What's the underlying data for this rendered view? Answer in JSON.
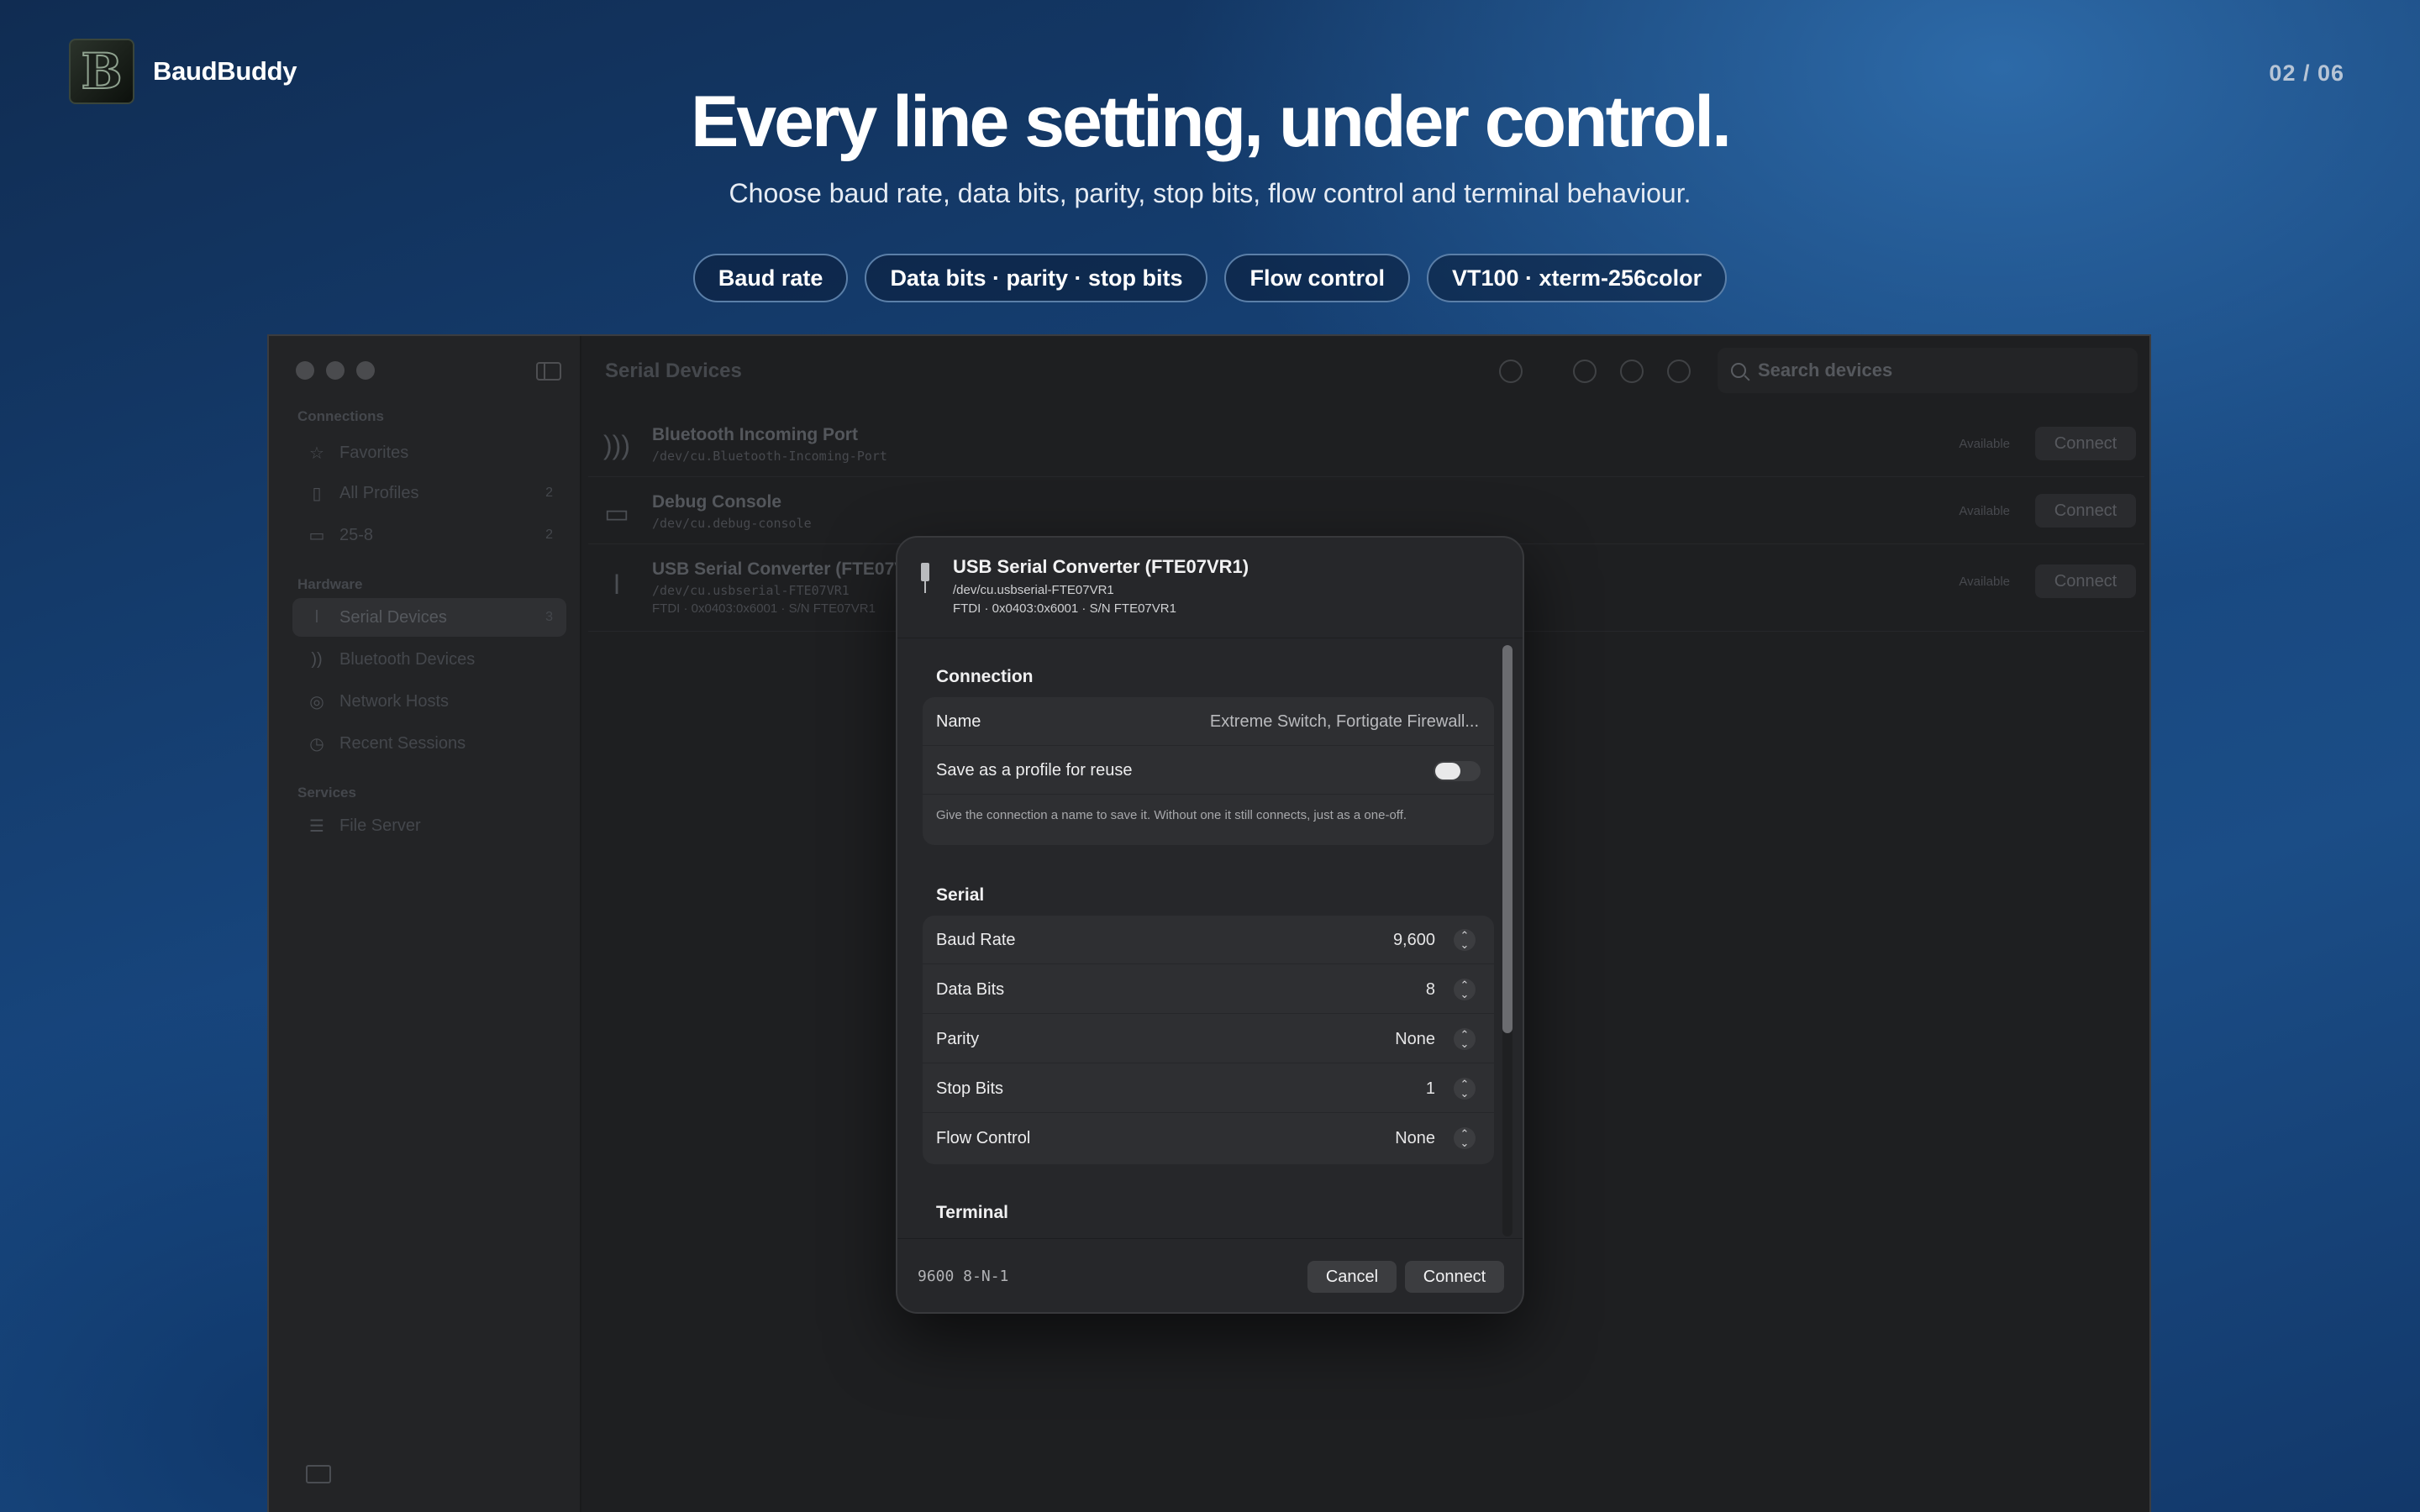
{
  "brand": {
    "name": "BaudBuddy",
    "logo_letter": "B"
  },
  "pager": "02 / 06",
  "headline": "Every line setting, under control.",
  "subline": "Choose baud rate, data bits, parity, stop bits, flow control and terminal behaviour.",
  "pills": [
    "Baud rate",
    "Data bits · parity · stop bits",
    "Flow control",
    "VT100 · xterm-256color"
  ],
  "window": {
    "title": "Serial Devices",
    "search_placeholder": "Search devices",
    "sidebar": {
      "sections": [
        "Connections",
        "Hardware",
        "Services"
      ],
      "connections": [
        {
          "label": "Favorites",
          "icon": "star-icon",
          "count": ""
        },
        {
          "label": "All Profiles",
          "icon": "clipboard-icon",
          "count": "2"
        },
        {
          "label": "25-8",
          "icon": "folder-icon",
          "count": "2"
        }
      ],
      "hardware": [
        {
          "label": "Serial Devices",
          "icon": "usb-icon",
          "count": "3"
        },
        {
          "label": "Bluetooth Devices",
          "icon": "bluetooth-icon",
          "count": ""
        },
        {
          "label": "Network Hosts",
          "icon": "globe-icon",
          "count": ""
        },
        {
          "label": "Recent Sessions",
          "icon": "clock-icon",
          "count": ""
        }
      ],
      "services": [
        {
          "label": "File Server",
          "icon": "server-icon",
          "count": ""
        }
      ]
    },
    "devices": [
      {
        "name": "Bluetooth Incoming Port",
        "path": "/dev/cu.Bluetooth-Incoming-Port",
        "info": "",
        "status": "Available",
        "action": "Connect"
      },
      {
        "name": "Debug Console",
        "path": "/dev/cu.debug-console",
        "info": "",
        "status": "Available",
        "action": "Connect"
      },
      {
        "name": "USB Serial Converter (FTE07V",
        "path": "/dev/cu.usbserial-FTE07VR1",
        "info": "FTDI · 0x0403:0x6001 · S/N FTE07VR1",
        "status": "Available",
        "action": "Connect"
      }
    ]
  },
  "sheet": {
    "title": "USB Serial Converter (FTE07VR1)",
    "path": "/dev/cu.usbserial-FTE07VR1",
    "info": "FTDI · 0x0403:0x6001 · S/N FTE07VR1",
    "connection": {
      "title": "Connection",
      "name_label": "Name",
      "name_placeholder": "Extreme Switch, Fortigate Firewall...",
      "save_label": "Save as a profile for reuse",
      "save_enabled": false,
      "helper": "Give the connection a name to save it. Without one it still connects, just as a one-off."
    },
    "serial": {
      "title": "Serial",
      "rows": [
        {
          "label": "Baud Rate",
          "value": "9,600"
        },
        {
          "label": "Data Bits",
          "value": "8"
        },
        {
          "label": "Parity",
          "value": "None"
        },
        {
          "label": "Stop Bits",
          "value": "1"
        },
        {
          "label": "Flow Control",
          "value": "None"
        }
      ]
    },
    "terminal": {
      "title": "Terminal"
    },
    "summary": "9600 8-N-1",
    "cancel": "Cancel",
    "connect": "Connect"
  }
}
